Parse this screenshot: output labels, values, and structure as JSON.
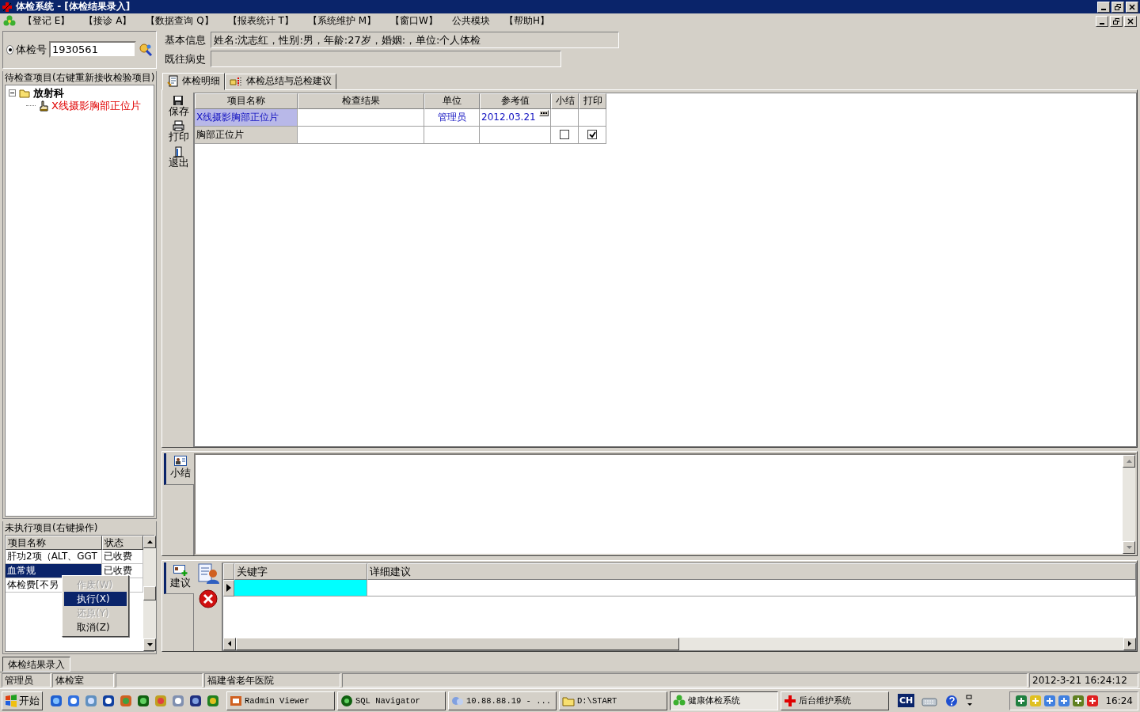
{
  "window": {
    "title": "体检系统 - [体检结果录入]"
  },
  "menu": [
    {
      "label": "【登记 E】"
    },
    {
      "label": "【接诊 A】"
    },
    {
      "label": "【数据查询 Q】"
    },
    {
      "label": "【报表统计 T】"
    },
    {
      "label": "【系统维护 M】"
    },
    {
      "label": "【窗口W】"
    },
    {
      "label": "公共模块"
    },
    {
      "label": "【帮助H】"
    }
  ],
  "patient": {
    "selected": true,
    "id_label": "体检号",
    "id_value": "1930561"
  },
  "info": {
    "basic_label": "基本信息",
    "basic_value": "姓名:沈志红，性别:男，年龄:27岁，婚姻:，单位:个人体检",
    "history_label": "既往病史"
  },
  "pending": {
    "title": "待检查项目(右键重新接收检验项目)",
    "tree": [
      {
        "label": "放射科",
        "expanded": true,
        "children": [
          {
            "label": "X线摄影胸部正位片"
          }
        ]
      }
    ]
  },
  "unexecuted": {
    "title": "未执行项目(右键操作)",
    "columns": [
      "项目名称",
      "状态"
    ],
    "rows": [
      {
        "name": "肝功2项（ALT、GGT",
        "status": "已收费",
        "selected": false
      },
      {
        "name": "血常规",
        "status": "已收费",
        "selected": true
      },
      {
        "name": "体检费[不另",
        "selected": false
      }
    ]
  },
  "context_menu": [
    {
      "label": "作废(W)",
      "disabled": true,
      "selected": false
    },
    {
      "label": "执行(X)",
      "disabled": false,
      "selected": true
    },
    {
      "label": "还原(Y)",
      "disabled": true,
      "selected": false
    },
    {
      "label": "取消(Z)",
      "disabled": false,
      "selected": false
    }
  ],
  "tabs": [
    {
      "label": "体检明细",
      "selected": true
    },
    {
      "label": "体检总结与总检建议",
      "selected": false
    }
  ],
  "toolbar": [
    {
      "kind": "save",
      "label": "保存"
    },
    {
      "kind": "print",
      "label": "打印"
    },
    {
      "kind": "exit",
      "label": "退出"
    }
  ],
  "detail_grid": {
    "columns": [
      "项目名称",
      "检查结果",
      "单位",
      "参考值",
      "小结",
      "打印"
    ],
    "rows": [
      {
        "kind": "group",
        "name": "X线摄影胸部正位片",
        "unit": "管理员",
        "reference": "2012.03.21",
        "selected": true
      },
      {
        "kind": "item",
        "name": "胸部正位片",
        "summary": false,
        "print": true,
        "selected": false
      }
    ]
  },
  "summary_panel": {
    "tab": "小结"
  },
  "advice_panel": {
    "tab": "建议",
    "columns": [
      "关键字",
      "详细建议"
    ]
  },
  "doc_tabs": [
    {
      "label": "体检结果录入",
      "selected": true
    }
  ],
  "status_bar": {
    "user": "管理员",
    "room": "体检室",
    "hospital": "福建省老年医院",
    "datetime": "2012-3-21 16:24:12"
  },
  "taskbar": {
    "start": "开始",
    "tasks": [
      {
        "label": "Radmin Viewer",
        "selected": false
      },
      {
        "label": "SQL Navigator",
        "selected": false
      },
      {
        "label": "10.88.88.19 - ...",
        "selected": false
      },
      {
        "label": "D:\\START",
        "selected": false
      },
      {
        "label": "健康体检系统",
        "selected": true
      },
      {
        "label": "后台维护系统",
        "selected": false
      }
    ],
    "language": "CH",
    "clock": "16:24"
  }
}
